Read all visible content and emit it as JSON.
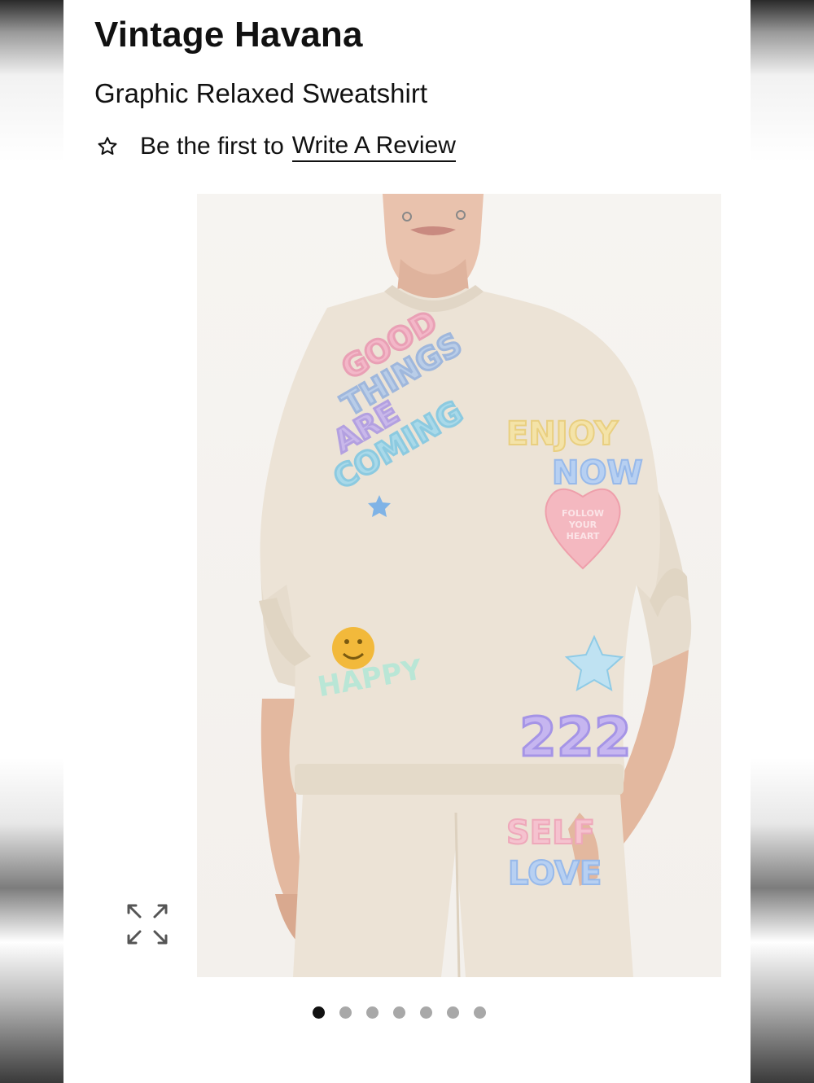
{
  "product": {
    "brand": "Vintage Havana",
    "name": "Graphic Relaxed Sweatshirt",
    "review_prompt": "Be the first to",
    "review_link": "Write A Review"
  },
  "image": {
    "alt": "Model wearing Graphic Relaxed Sweatshirt",
    "graphics": {
      "top_left": [
        "GOOD",
        "THINGS",
        "ARE",
        "COMING"
      ],
      "top_right": [
        "ENJOY",
        "NOW"
      ],
      "heart": [
        "FOLLOW",
        "YOUR",
        "HEART"
      ],
      "number": "222",
      "smiley_text": "HAPPY",
      "pants": [
        "SELF",
        "LOVE"
      ]
    }
  },
  "carousel": {
    "total": 7,
    "active_index": 0
  },
  "icons": {
    "review": "star-outline-icon",
    "expand": "expand-icon"
  },
  "colors": {
    "text": "#111111",
    "dot_active": "#111111",
    "dot_inactive": "#a8a8a8",
    "sweatshirt": "#ece3d6"
  }
}
